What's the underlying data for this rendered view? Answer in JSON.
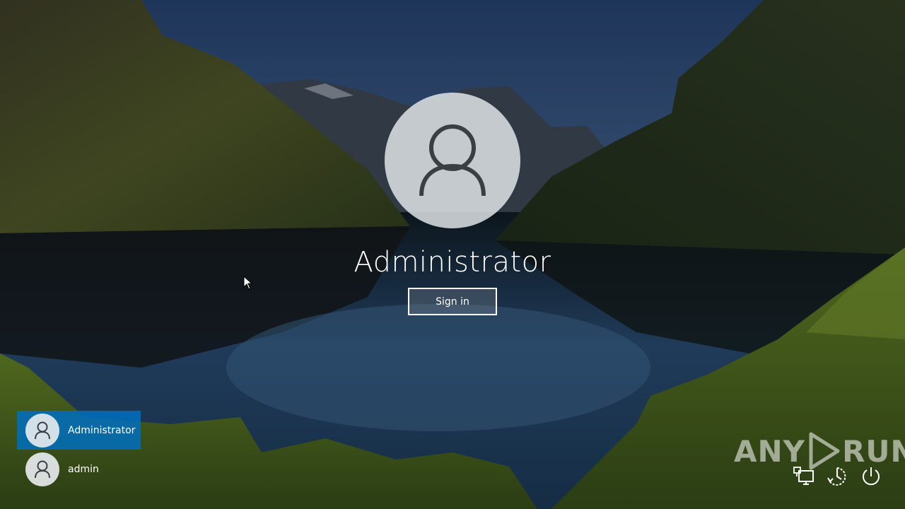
{
  "lock_screen": {
    "current_user": "Administrator",
    "sign_in_label": "Sign in"
  },
  "users": [
    {
      "name": "Administrator",
      "selected": true,
      "icon": "user-icon"
    },
    {
      "name": "admin",
      "selected": false,
      "icon": "user-icon"
    }
  ],
  "watermark": {
    "left": "ANY",
    "right": "RUN"
  },
  "tray": {
    "network_icon": "network-icon",
    "accessibility_icon": "ease-of-access-icon",
    "power_icon": "power-icon"
  },
  "colors": {
    "selected_user_bg": "#006ebe",
    "text": "#ffffff"
  }
}
